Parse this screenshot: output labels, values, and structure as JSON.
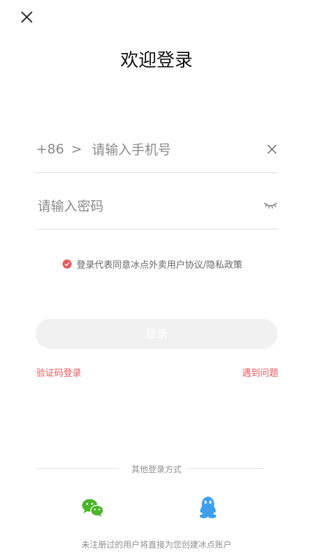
{
  "header": {
    "close_icon": "close-icon",
    "title": "欢迎登录"
  },
  "phone": {
    "country_code": "+86",
    "arrow": ">",
    "placeholder": "请输入手机号",
    "value": "",
    "clear_icon": "clear-icon"
  },
  "password": {
    "placeholder": "请输入密码",
    "value": "",
    "visibility_icon": "eye-closed-icon"
  },
  "agreement": {
    "checked": true,
    "text": "登录代表同意冰点外卖用户协议/隐私政策",
    "check_color": "#e65a5a"
  },
  "login_button": {
    "label": "登录"
  },
  "links": {
    "sms_login": "验证码登录",
    "help": "遇到问题"
  },
  "other_login": {
    "label": "其他登录方式",
    "options": [
      "wechat-icon",
      "qq-icon"
    ]
  },
  "footer": {
    "text": "未注册过的用户将直接为您创建冰点账户"
  },
  "colors": {
    "accent": "#e65a5a",
    "wechat": "#4bb52a",
    "qq": "#3ea0ec"
  }
}
